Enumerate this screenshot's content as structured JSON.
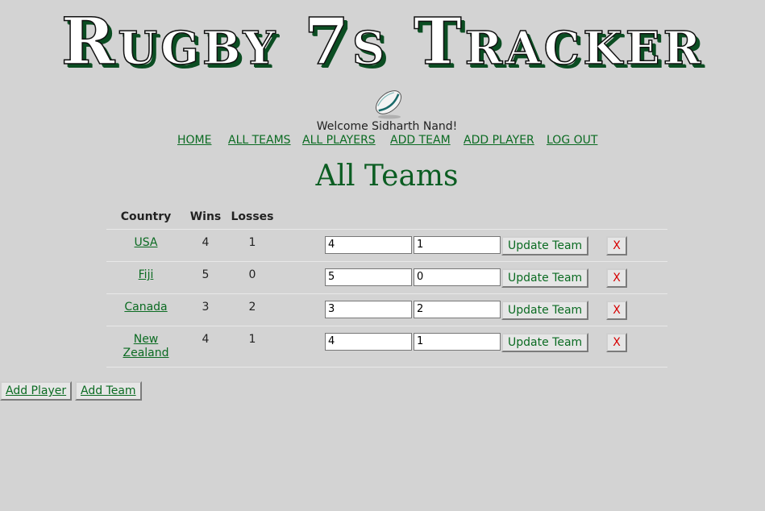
{
  "header": {
    "title": "Rugby 7s Tracker",
    "welcome": "Welcome Sidharth Nand!"
  },
  "nav": [
    "HOME",
    "ALL TEAMS",
    "ALL PLAYERS",
    "ADD TEAM",
    "ADD PLAYER",
    "LOG OUT"
  ],
  "page_title": "All Teams",
  "table": {
    "columns": [
      "Country",
      "Wins",
      "Losses"
    ],
    "update_label": "Update Team",
    "delete_label": "X",
    "rows": [
      {
        "country": "USA",
        "wins": "4",
        "losses": "1",
        "wins_input": "4",
        "losses_input": "1"
      },
      {
        "country": "Fiji",
        "wins": "5",
        "losses": "0",
        "wins_input": "5",
        "losses_input": "0"
      },
      {
        "country": "Canada",
        "wins": "3",
        "losses": "2",
        "wins_input": "3",
        "losses_input": "2"
      },
      {
        "country": "New Zealand",
        "wins": "4",
        "losses": "1",
        "wins_input": "4",
        "losses_input": "1"
      }
    ]
  },
  "footer_buttons": {
    "add_player": "Add Player",
    "add_team": "Add Team"
  },
  "colors": {
    "background": "#d3d3d3",
    "link_green": "#0b6b22",
    "title_green": "#0b5d22",
    "delete_red": "#d60000"
  },
  "icons": {
    "logo": "rugby-ball-icon"
  }
}
